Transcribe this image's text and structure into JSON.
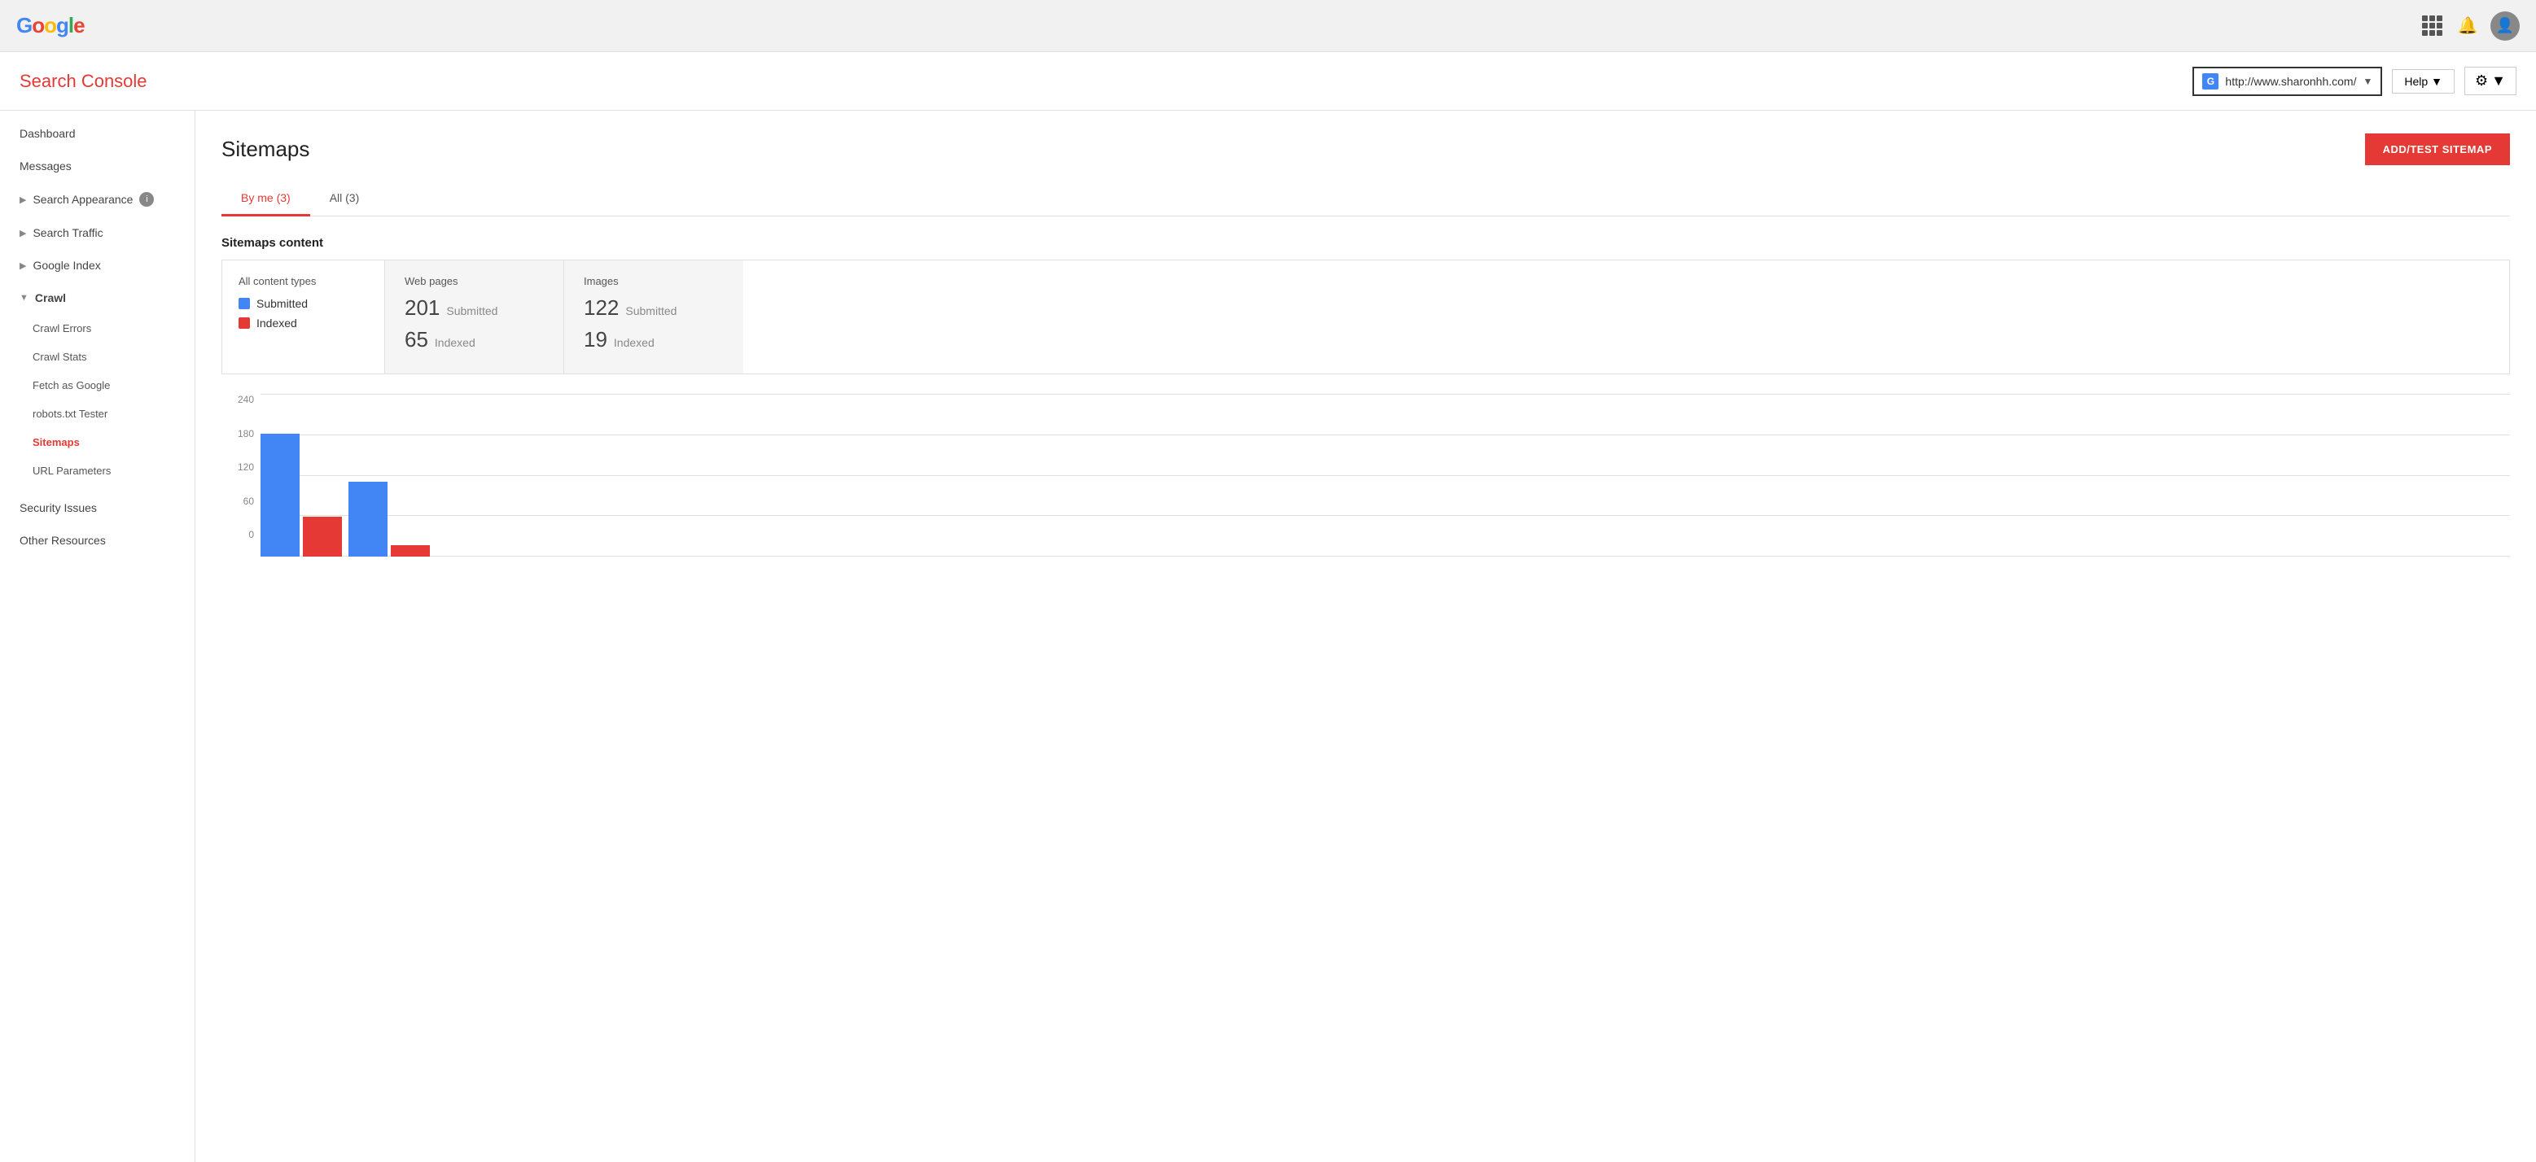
{
  "topBar": {
    "logo": "Google",
    "logo_parts": [
      "G",
      "o",
      "o",
      "g",
      "l",
      "e"
    ]
  },
  "secondBar": {
    "title": "Search Console",
    "site": {
      "badge": "G",
      "url": "http://www.sharonhh.com/",
      "chevron": "▼"
    },
    "help_label": "Help",
    "help_chevron": "▼",
    "gear_icon": "⚙",
    "gear_chevron": "▼"
  },
  "sidebar": {
    "items": [
      {
        "id": "dashboard",
        "label": "Dashboard",
        "indent": false,
        "active": false
      },
      {
        "id": "messages",
        "label": "Messages",
        "indent": false,
        "active": false
      },
      {
        "id": "search-appearance",
        "label": "Search Appearance",
        "indent": false,
        "active": false,
        "arrow": "▶",
        "info": true
      },
      {
        "id": "search-traffic",
        "label": "Search Traffic",
        "indent": false,
        "active": false,
        "arrow": "▶"
      },
      {
        "id": "google-index",
        "label": "Google Index",
        "indent": false,
        "active": false,
        "arrow": "▶"
      },
      {
        "id": "crawl",
        "label": "Crawl",
        "indent": false,
        "active": false,
        "arrow": "▼",
        "section": true
      }
    ],
    "crawl_items": [
      {
        "id": "crawl-errors",
        "label": "Crawl Errors",
        "active": false
      },
      {
        "id": "crawl-stats",
        "label": "Crawl Stats",
        "active": false
      },
      {
        "id": "fetch-as-google",
        "label": "Fetch as Google",
        "active": false
      },
      {
        "id": "robots-tester",
        "label": "robots.txt Tester",
        "active": false
      },
      {
        "id": "sitemaps",
        "label": "Sitemaps",
        "active": true
      },
      {
        "id": "url-parameters",
        "label": "URL Parameters",
        "active": false
      }
    ],
    "bottom_items": [
      {
        "id": "security-issues",
        "label": "Security Issues",
        "active": false
      },
      {
        "id": "other-resources",
        "label": "Other Resources",
        "active": false
      }
    ]
  },
  "page": {
    "title": "Sitemaps",
    "add_button": "ADD/TEST SITEMAP"
  },
  "tabs": [
    {
      "id": "by-me",
      "label": "By me (3)",
      "active": true
    },
    {
      "id": "all",
      "label": "All (3)",
      "active": false
    }
  ],
  "sitemaps_content": {
    "section_label": "Sitemaps content",
    "content_types_label": "All content types",
    "legend": [
      {
        "id": "submitted",
        "color": "#4285F4",
        "label": "Submitted"
      },
      {
        "id": "indexed",
        "color": "#E53935",
        "label": "Indexed"
      }
    ],
    "cells": [
      {
        "id": "web-pages",
        "title": "Web pages",
        "stats": [
          {
            "number": "201",
            "label": "Submitted"
          },
          {
            "number": "65",
            "label": "Indexed"
          }
        ]
      },
      {
        "id": "images",
        "title": "Images",
        "stats": [
          {
            "number": "122",
            "label": "Submitted"
          },
          {
            "number": "19",
            "label": "Indexed"
          }
        ]
      }
    ]
  },
  "chart": {
    "y_labels": [
      "240",
      "180",
      "120",
      "60",
      "0"
    ],
    "max": 240,
    "bars": [
      {
        "blue": 201,
        "red": 65
      },
      {
        "blue": 122,
        "red": 19
      }
    ]
  }
}
